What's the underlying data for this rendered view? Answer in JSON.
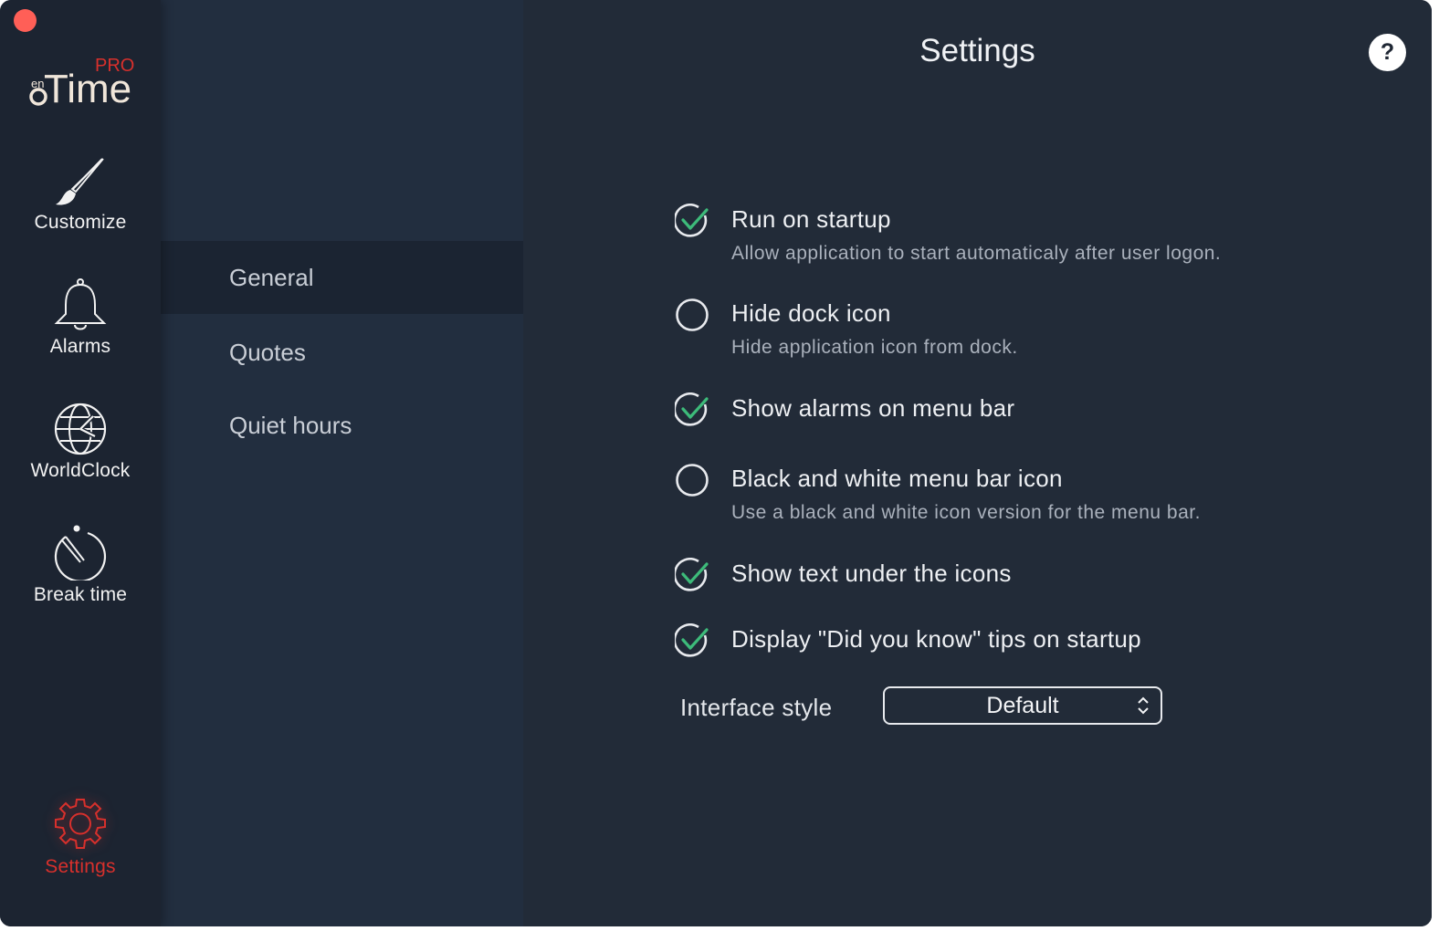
{
  "app": {
    "logo_text": "Time",
    "logo_badge": "PRO",
    "logo_prefix": "en"
  },
  "colors": {
    "accent_red": "#d8302c",
    "check_green": "#3dbb7a",
    "window_bg": "#222b38"
  },
  "sidebar": {
    "items": [
      {
        "label": "Customize",
        "icon": "paintbrush-icon"
      },
      {
        "label": "Alarms",
        "icon": "bell-icon"
      },
      {
        "label": "WorldClock",
        "icon": "globe-clock-icon"
      },
      {
        "label": "Break time",
        "icon": "stopwatch-icon"
      }
    ],
    "settings": {
      "label": "Settings",
      "icon": "gear-icon",
      "active": true
    }
  },
  "subnav": {
    "items": [
      {
        "label": "General",
        "selected": true
      },
      {
        "label": "Quotes",
        "selected": false
      },
      {
        "label": "Quiet hours",
        "selected": false
      }
    ]
  },
  "main": {
    "title": "Settings",
    "help_label": "?",
    "options": [
      {
        "label": "Run on startup",
        "description": "Allow application to start automaticaly after user logon.",
        "checked": true
      },
      {
        "label": "Hide dock icon",
        "description": "Hide application icon from dock.",
        "checked": false
      },
      {
        "label": "Show alarms on menu bar",
        "description": "",
        "checked": true
      },
      {
        "label": "Black and white menu bar icon",
        "description": "Use a black and white icon version for the menu bar.",
        "checked": false
      },
      {
        "label": "Show text under the icons",
        "description": "",
        "checked": true
      },
      {
        "label": "Display \"Did you know\" tips on startup",
        "description": "",
        "checked": true
      }
    ],
    "interface_style": {
      "label": "Interface style",
      "value": "Default"
    }
  }
}
